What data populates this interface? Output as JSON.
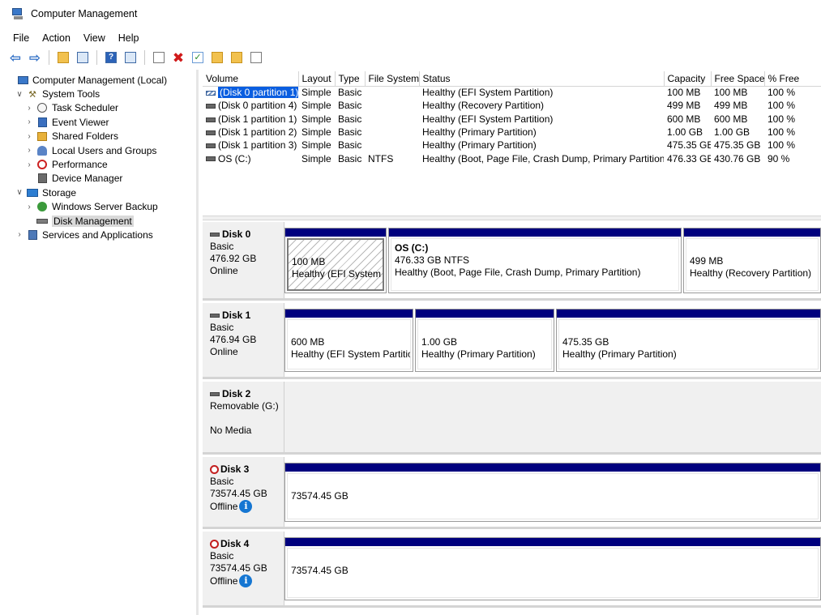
{
  "window": {
    "title": "Computer Management"
  },
  "menu": [
    "File",
    "Action",
    "View",
    "Help"
  ],
  "toolbar": [
    {
      "name": "back-arrow-icon"
    },
    {
      "name": "forward-arrow-icon"
    },
    {
      "name": "up-folder-icon"
    },
    {
      "name": "show-hide-tree-icon"
    },
    {
      "name": "help-icon"
    },
    {
      "name": "action-pane-icon"
    },
    {
      "name": "connect-icon"
    },
    {
      "name": "delete-icon"
    },
    {
      "name": "check-icon"
    },
    {
      "name": "export-icon"
    },
    {
      "name": "rescan-icon"
    },
    {
      "name": "properties-icon"
    }
  ],
  "tree": [
    {
      "label": "Computer Management (Local)",
      "level": 0,
      "expander": "",
      "icon": "computer-icon"
    },
    {
      "label": "System Tools",
      "level": 1,
      "expander": "expanded",
      "icon": "tools-icon"
    },
    {
      "label": "Task Scheduler",
      "level": 2,
      "expander": "collapsed",
      "icon": "clock-icon"
    },
    {
      "label": "Event Viewer",
      "level": 2,
      "expander": "collapsed",
      "icon": "event-viewer-icon"
    },
    {
      "label": "Shared Folders",
      "level": 2,
      "expander": "collapsed",
      "icon": "shared-folder-icon"
    },
    {
      "label": "Local Users and Groups",
      "level": 2,
      "expander": "collapsed",
      "icon": "users-icon"
    },
    {
      "label": "Performance",
      "level": 2,
      "expander": "collapsed",
      "icon": "performance-icon"
    },
    {
      "label": "Device Manager",
      "level": 2,
      "expander": "",
      "icon": "device-manager-icon"
    },
    {
      "label": "Storage",
      "level": 1,
      "expander": "expanded",
      "icon": "storage-icon"
    },
    {
      "label": "Windows Server Backup",
      "level": 2,
      "expander": "collapsed",
      "icon": "backup-icon"
    },
    {
      "label": "Disk Management",
      "level": 2,
      "expander": "",
      "icon": "disk-icon",
      "selected": true
    },
    {
      "label": "Services and Applications",
      "level": 1,
      "expander": "collapsed",
      "icon": "services-icon"
    }
  ],
  "volumes": {
    "headers": [
      "Volume",
      "Layout",
      "Type",
      "File System",
      "Status",
      "Capacity",
      "Free Space",
      "% Free"
    ],
    "rows": [
      {
        "volume": "(Disk 0 partition 1)",
        "layout": "Simple",
        "type": "Basic",
        "fs": "",
        "status": "Healthy (EFI System Partition)",
        "capacity": "100 MB",
        "free": "100 MB",
        "pct": "100 %",
        "selected": true,
        "efi": true
      },
      {
        "volume": "(Disk 0 partition 4)",
        "layout": "Simple",
        "type": "Basic",
        "fs": "",
        "status": "Healthy (Recovery Partition)",
        "capacity": "499 MB",
        "free": "499 MB",
        "pct": "100 %"
      },
      {
        "volume": "(Disk 1 partition 1)",
        "layout": "Simple",
        "type": "Basic",
        "fs": "",
        "status": "Healthy (EFI System Partition)",
        "capacity": "600 MB",
        "free": "600 MB",
        "pct": "100 %"
      },
      {
        "volume": "(Disk 1 partition 2)",
        "layout": "Simple",
        "type": "Basic",
        "fs": "",
        "status": "Healthy (Primary Partition)",
        "capacity": "1.00 GB",
        "free": "1.00 GB",
        "pct": "100 %"
      },
      {
        "volume": "(Disk 1 partition 3)",
        "layout": "Simple",
        "type": "Basic",
        "fs": "",
        "status": "Healthy (Primary Partition)",
        "capacity": "475.35 GB",
        "free": "475.35 GB",
        "pct": "100 %"
      },
      {
        "volume": "OS (C:)",
        "layout": "Simple",
        "type": "Basic",
        "fs": "NTFS",
        "status": "Healthy (Boot, Page File, Crash Dump, Primary Partition)",
        "capacity": "476.33 GB",
        "free": "430.76 GB",
        "pct": "90 %"
      }
    ]
  },
  "disks": [
    {
      "id": "disk0",
      "name": "Disk 0",
      "lines": [
        "Basic",
        "476.92 GB",
        "Online"
      ],
      "offline": false,
      "partitions": [
        {
          "name": "",
          "size": "100 MB",
          "status": "Healthy (EFI System Partition)",
          "hatched": true,
          "selected": true
        },
        {
          "name": "OS  (C:)",
          "size": "476.33 GB NTFS",
          "status": "Healthy (Boot, Page File, Crash Dump, Primary Partition)"
        },
        {
          "name": "",
          "size": "499 MB",
          "status": "Healthy (Recovery Partition)"
        }
      ]
    },
    {
      "id": "disk1",
      "name": "Disk 1",
      "lines": [
        "Basic",
        "476.94 GB",
        "Online"
      ],
      "offline": false,
      "partitions": [
        {
          "name": "",
          "size": "600 MB",
          "status": "Healthy (EFI System Partition)"
        },
        {
          "name": "",
          "size": "1.00 GB",
          "status": "Healthy (Primary Partition)"
        },
        {
          "name": "",
          "size": "475.35 GB",
          "status": "Healthy (Primary Partition)"
        }
      ]
    },
    {
      "id": "disk2",
      "name": "Disk 2",
      "lines": [
        "Removable (G:)",
        "",
        "No Media"
      ],
      "offline": false,
      "nomedia": true,
      "partitions": []
    },
    {
      "id": "disk3",
      "name": "Disk 3",
      "lines": [
        "Basic",
        "73574.45 GB",
        "Offline"
      ],
      "offline": true,
      "partitions": [
        {
          "name": "",
          "size": "73574.45 GB",
          "status": ""
        }
      ]
    },
    {
      "id": "disk4",
      "name": "Disk 4",
      "lines": [
        "Basic",
        "73574.45 GB",
        "Offline"
      ],
      "offline": true,
      "partitions": [
        {
          "name": "",
          "size": "73574.45 GB",
          "status": ""
        }
      ]
    }
  ],
  "colors": {
    "partition_bar": "#00007e",
    "selection": "#0a5ee0",
    "info_icon": "#1576d2"
  }
}
